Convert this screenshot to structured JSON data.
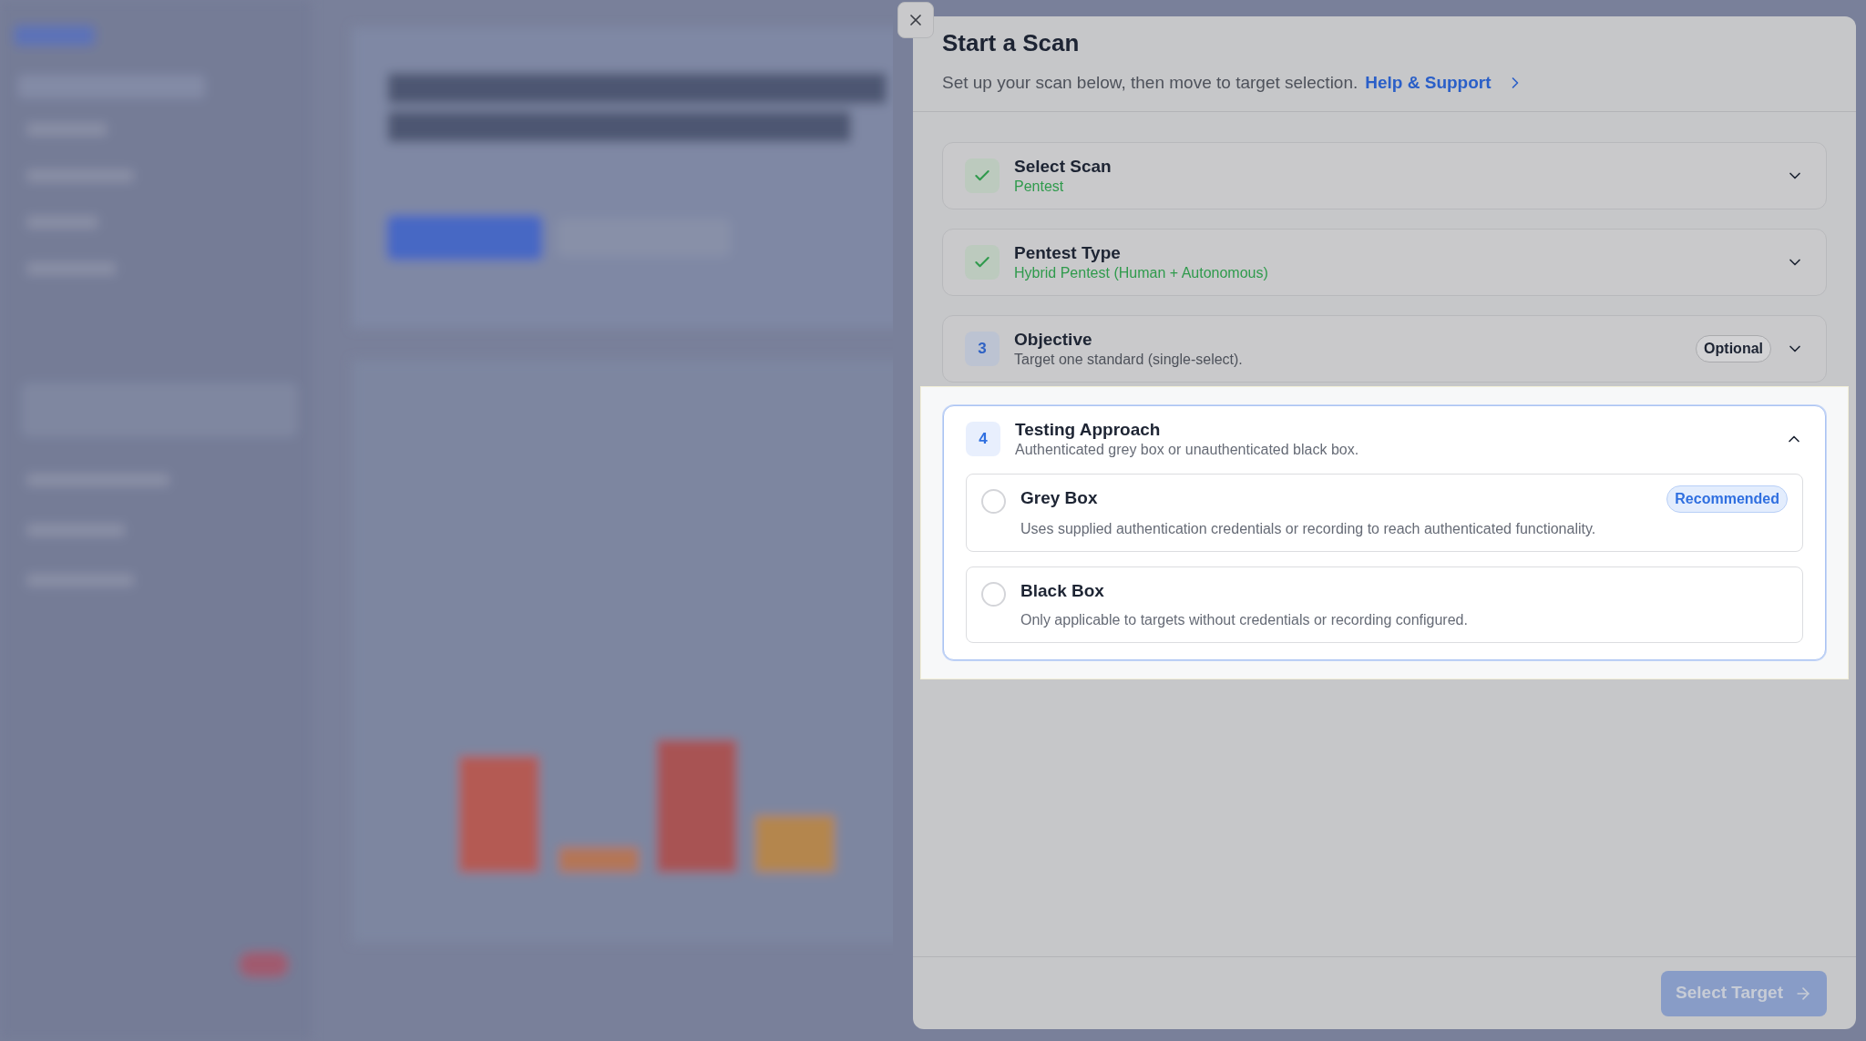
{
  "dialog": {
    "title": "Start a Scan",
    "subtitle": "Set up your scan below, then move to target selection.",
    "help_link": "Help & Support"
  },
  "steps": [
    {
      "kind": "done",
      "title": "Select Scan",
      "summary": "Pentest",
      "expanded": false,
      "highlighted": false
    },
    {
      "kind": "done",
      "title": "Pentest Type",
      "summary": "Hybrid Pentest (Human + Autonomous)",
      "expanded": false,
      "highlighted": false
    },
    {
      "kind": "pending",
      "number": "3",
      "title": "Objective",
      "summary": "Target one standard (single-select).",
      "badge": "Optional",
      "expanded": false,
      "highlighted": false
    },
    {
      "kind": "pending",
      "number": "4",
      "title": "Testing Approach",
      "summary": "Authenticated grey box or unauthenticated black box.",
      "expanded": true,
      "highlighted": true,
      "options": [
        {
          "label": "Grey Box",
          "description": "Uses supplied authentication credentials or recording to reach authenticated functionality.",
          "badge": "Recommended",
          "selected": false
        },
        {
          "label": "Black Box",
          "description": "Only applicable to targets without credentials or recording configured.",
          "selected": false
        }
      ]
    }
  ],
  "footer": {
    "button": "Select Target",
    "disabled": true
  }
}
